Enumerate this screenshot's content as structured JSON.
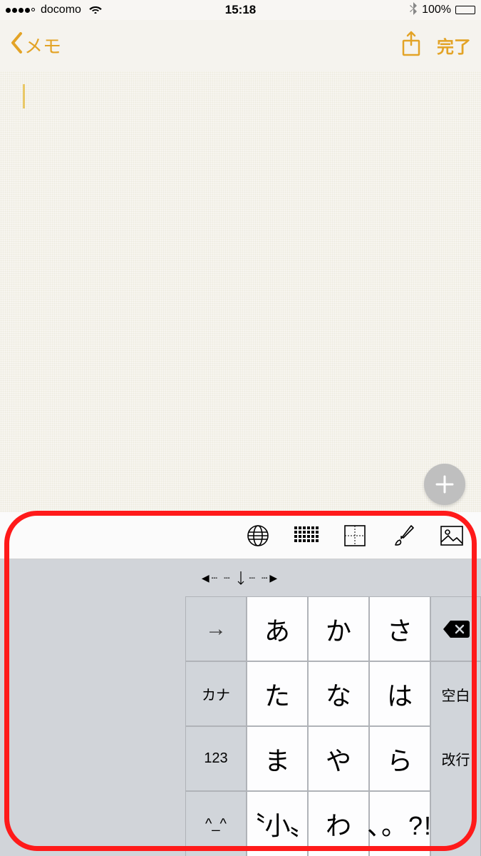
{
  "status": {
    "carrier": "docomo",
    "time": "15:18",
    "battery_pct": "100%"
  },
  "nav": {
    "back_label": "メモ",
    "done_label": "完了"
  },
  "keyboard": {
    "func": {
      "arrow": "→",
      "kana": "カナ",
      "num": "123",
      "emoji": "^_^"
    },
    "chars": {
      "r1": [
        "あ",
        "か",
        "さ"
      ],
      "r2": [
        "た",
        "な",
        "は"
      ],
      "r3": [
        "ま",
        "や",
        "ら"
      ],
      "r4": [
        "〝小〟",
        "わ",
        "、。?!"
      ]
    },
    "right": {
      "space": "空白",
      "return": "改行"
    }
  }
}
